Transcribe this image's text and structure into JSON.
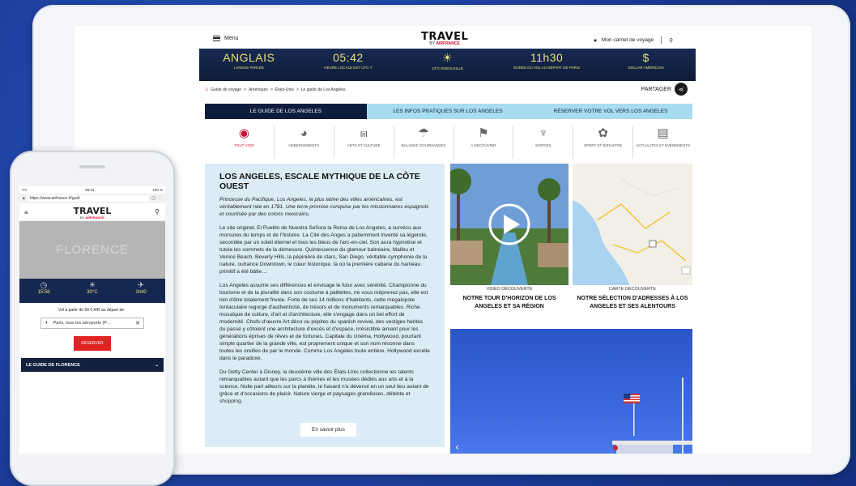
{
  "header": {
    "menu_label": "Menu",
    "logo_title": "TRAVEL",
    "logo_by": "BY",
    "logo_brand": "AIRFRANCE",
    "carnet_label": "Mon carnet de voyage"
  },
  "infobar": [
    {
      "value": "ANGLAIS",
      "caption": "LANGUE PARLÉE"
    },
    {
      "value": "05:42",
      "caption": "HEURE LOCALE EST UTC-7"
    },
    {
      "value": "☀",
      "caption": "23°C ENSOLEILLÉ"
    },
    {
      "value": "11h30",
      "caption": "DURÉE DU VOL AU DÉPART DE PARIS"
    },
    {
      "value": "$",
      "caption": "DOLLAR AMÉRICAIN"
    }
  ],
  "breadcrumb": [
    "Guide de voyage",
    "Amériques",
    "États-Unis",
    "Le guide de Los Angeles"
  ],
  "share_label": "PARTAGER",
  "tabs": [
    "LE GUIDE DE LOS ANGELES",
    "LES INFOS PRATIQUES SUR LOS ANGELES",
    "RÉSERVER VOTRE VOL VERS LOS ANGELES"
  ],
  "categories": [
    {
      "icon": "eye-icon",
      "label": "TOUT VOIR"
    },
    {
      "icon": "bed-icon",
      "label": "HÉBERGEMENTS"
    },
    {
      "icon": "monument-icon",
      "label": "ARTS ET CULTURE"
    },
    {
      "icon": "umbrella-icon",
      "label": "BALADES GOURMANDES"
    },
    {
      "icon": "flag-icon",
      "label": "À DÉCOUVRIR"
    },
    {
      "icon": "glasses-icon",
      "label": "SORTIES"
    },
    {
      "icon": "lotus-icon",
      "label": "SPORT ET BIEN-ÊTRE"
    },
    {
      "icon": "news-icon",
      "label": "ACTUALITÉS ET ÉVÉNEMENTS"
    }
  ],
  "article": {
    "title": "LOS ANGELES, ESCALE MYTHIQUE DE LA CÔTE OUEST",
    "lead": "Princesse du Pacifique, Los Angeles, la plus latine des villes américaines, est véritablement née en 1781. Une terre promise conquise par les missionnaires espagnols et courtisée par des colons mexicains.",
    "p1": "Le site originel, El Pueblo de Nuestra Señora la Reina de Los Angeles, a survécu aux morsures du temps et de l'histoire. La Cité des Anges a patiemment inventé sa légende, secondée par un soleil éternel et tous les bleus de l'arc-en-ciel. Son aura hypnotise et tutoie les sommets de la démesure. Quintessence du glamour balnéaire, Malibu et Venice Beach, Beverly Hills, la pépinière de stars, San Diego, véritable symphonie de la nature, outrance Downtown, le cœur historique, là où la première cabane du hameau primitif a été bâtie…",
    "p2": "Los Angeles assume ses différences et envisage le futur avec sérénité. Championne du tourisme et de la pluralité dans son costume à paillettes, ne vous méprenez pas, elle est loin d'être totalement frivole. Forte de ses 14 millions d'habitants, cette mégalopole tentaculaire regorge d'authenticité, de trésors et de monuments remarquables. Riche mosaïque de culture, d'art et d'architecture, elle s'engage dans un bel effort de modernité. Chefs-d'œuvre Art déco ou pépites du spanish revival, des vestiges hérités du passé y côtoient une architecture d'excès et d'espace, irrésistible aimant pour les générations éprises de rêves et de fortunes. Capitale du cinéma, Hollywood, pourtant simple quartier de la grande ville, est proprement unique et son nom résonne dans toutes les oreilles de par le monde. Comme Los Angeles toute entière, Hollywood excelle dans le paradoxe.",
    "p3": "Du Getty Center à Disney, la deuxième ville des États-Unis collectionne les talents remarquables autant que les parcs à thèmes et les musées dédiés aux arts et à la science. Nulle part ailleurs sur la planète, le hasard n'a déversé en un seul lieu autant de grâce et d'occasions de plaisir. Nature vierge et paysages grandioses, détente et shopping.",
    "more_label": "En savoir plus"
  },
  "media": [
    {
      "kicker": "VIDÉO DÉCOUVERTE",
      "title": "NOTRE TOUR D'HORIZON DE LOS ANGELES ET SA RÉGION"
    },
    {
      "kicker": "CARTE DÉCOUVERTE",
      "title": "NOTRE SÉLECTION D'ADRESSES À LOS ANGELES ET SES ALENTOURS"
    }
  ],
  "phone": {
    "time": "09:41",
    "battery": "100 %",
    "url": "https://www.airfrance.fr/guid",
    "hero": "FLORENCE",
    "info": [
      {
        "icon": "clock-icon",
        "value": "15:58"
      },
      {
        "icon": "sun-cloud-icon",
        "value": "30°C"
      },
      {
        "icon": "plane-icon",
        "value": "1h40"
      }
    ],
    "vol_text": "Vol à partir de 99 € A/R au départ de :",
    "departure": "Paris, tous les aéroports (P…",
    "reserve_label": "RÉSERVER",
    "guide_label": "LE GUIDE DE FLORENCE"
  }
}
